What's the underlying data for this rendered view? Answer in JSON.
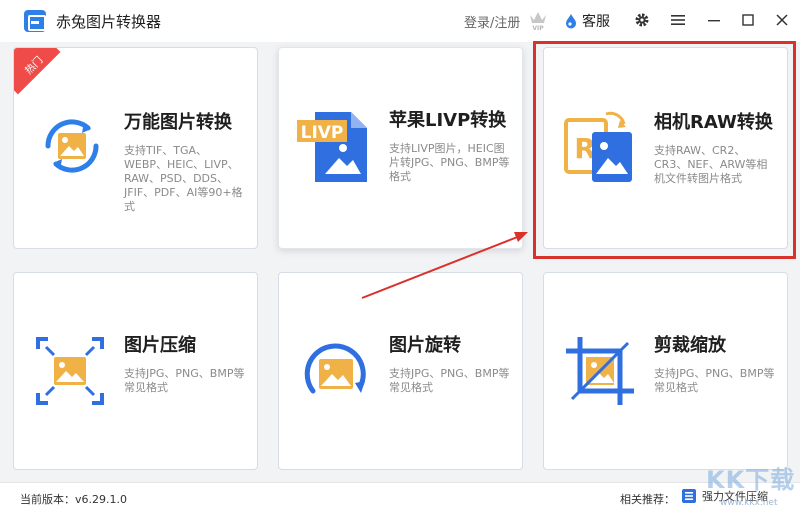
{
  "app": {
    "title": "赤兔图片转换器",
    "login": "登录/注册",
    "service": "客服"
  },
  "cards": [
    {
      "title": "万能图片转换",
      "desc": "支持TIF、TGA、WEBP、HEIC、LIVP、RAW、PSD、DDS、JFIF、PDF、AI等90+格式",
      "badge": "热门"
    },
    {
      "title": "苹果LIVP转换",
      "desc": "支持LIVP图片，HEIC图片转JPG、PNG、BMP等格式",
      "icon_text": "LIVP"
    },
    {
      "title": "相机RAW转换",
      "desc": "支持RAW、CR2、CR3、NEF、ARW等相机文件转图片格式",
      "icon_text": "R"
    },
    {
      "title": "图片压缩",
      "desc": "支持JPG、PNG、BMP等常见格式"
    },
    {
      "title": "图片旋转",
      "desc": "支持JPG、PNG、BMP等常见格式"
    },
    {
      "title": "剪裁缩放",
      "desc": "支持JPG、PNG、BMP等常见格式"
    }
  ],
  "footer": {
    "version": "当前版本：v6.29.1.0",
    "related": "相关推荐：",
    "compress_link": "强力文件压缩"
  },
  "watermark": {
    "text": "KK下载",
    "url": "www.kkx.net"
  },
  "colors": {
    "accent_blue": "#2f7fe8",
    "accent_orange": "#f0b247",
    "highlight_red": "#d9312b"
  }
}
